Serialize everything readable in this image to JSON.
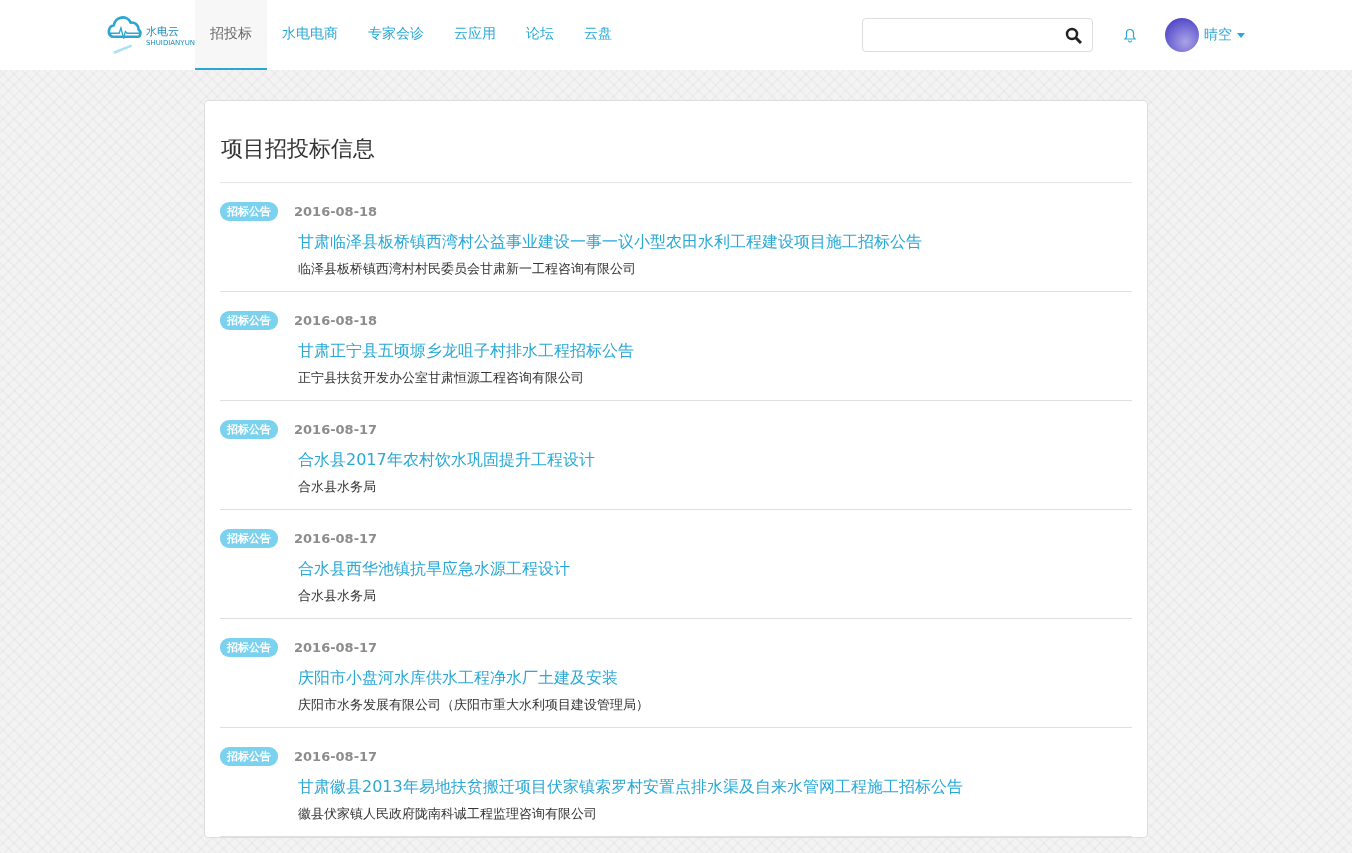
{
  "logo": {
    "name": "水电云",
    "subtitle": "SHUIDIANYUN"
  },
  "nav": [
    {
      "label": "招投标",
      "selected": true
    },
    {
      "label": "水电电商",
      "selected": false
    },
    {
      "label": "专家会诊",
      "selected": false
    },
    {
      "label": "云应用",
      "selected": false
    },
    {
      "label": "论坛",
      "selected": false
    },
    {
      "label": "云盘",
      "selected": false
    }
  ],
  "user": {
    "name": "晴空"
  },
  "page_title": "项目招投标信息",
  "notices": [
    {
      "tag": "招标公告",
      "date": "2016-08-18",
      "title": "甘肃临泽县板桥镇西湾村公益事业建设一事一议小型农田水利工程建设项目施工招标公告",
      "publisher": "临泽县板桥镇西湾村村民委员会甘肃新一工程咨询有限公司"
    },
    {
      "tag": "招标公告",
      "date": "2016-08-18",
      "title": "甘肃正宁县五顷塬乡龙咀子村排水工程招标公告",
      "publisher": "正宁县扶贫开发办公室甘肃恒源工程咨询有限公司"
    },
    {
      "tag": "招标公告",
      "date": "2016-08-17",
      "title": "合水县2017年农村饮水巩固提升工程设计",
      "publisher": "合水县水务局"
    },
    {
      "tag": "招标公告",
      "date": "2016-08-17",
      "title": "合水县西华池镇抗旱应急水源工程设计",
      "publisher": "合水县水务局"
    },
    {
      "tag": "招标公告",
      "date": "2016-08-17",
      "title": "庆阳市小盘河水库供水工程净水厂土建及安装",
      "publisher": "庆阳市水务发展有限公司（庆阳市重大水利项目建设管理局）"
    },
    {
      "tag": "招标公告",
      "date": "2016-08-17",
      "title": "甘肃徽县2013年易地扶贫搬迁项目伏家镇索罗村安置点排水渠及自来水管网工程施工招标公告",
      "publisher": "徽县伏家镇人民政府陇南科诚工程监理咨询有限公司"
    }
  ]
}
